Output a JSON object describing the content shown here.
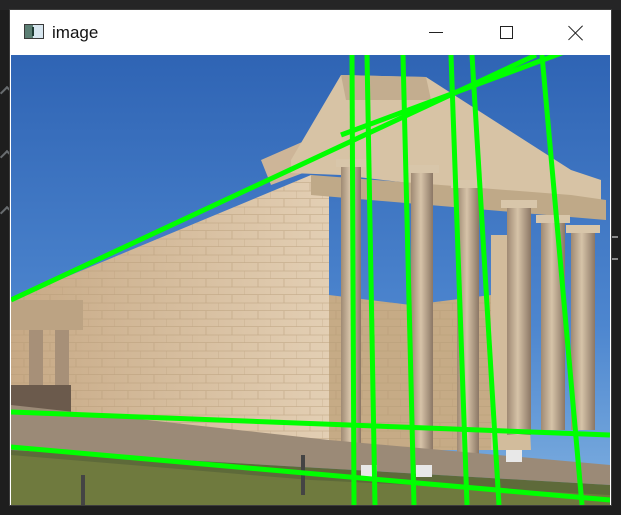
{
  "window": {
    "title": "image",
    "icon": "window-app-icon",
    "controls": [
      "minimize-icon",
      "maximize-icon",
      "close-icon"
    ]
  },
  "canvas": {
    "subject": "photograph",
    "line_color": "#00ff00"
  }
}
